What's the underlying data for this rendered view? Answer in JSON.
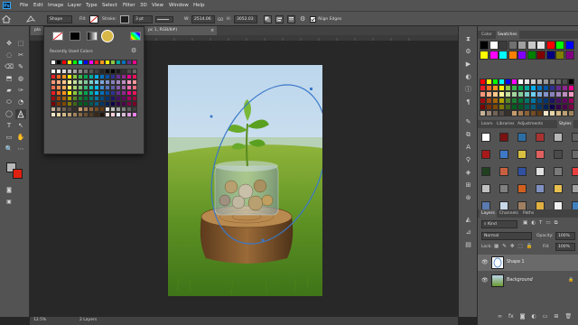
{
  "menubar": {
    "logo": "Ps",
    "items": [
      "File",
      "Edit",
      "Image",
      "Layer",
      "Type",
      "Select",
      "Filter",
      "3D",
      "View",
      "Window",
      "Help"
    ]
  },
  "options": {
    "mode": "Shape",
    "fill_label": "Fill:",
    "stroke_label": "Stroke:",
    "stroke_width": "3 pt",
    "w_label": "W:",
    "w_value": "2514.06",
    "link_glyph": "GO",
    "h_label": "H:",
    "h_value": "3052.03",
    "align_edges": "Align Edges"
  },
  "doc_tabs": [
    "pla",
    "pc 1, RGB/8#)"
  ],
  "swatch_flyout": {
    "title": "Recently Used Colors",
    "recent": [
      "#ffffff",
      "#000000",
      "#ff0000",
      "#ffff00",
      "#00ff00",
      "#00ffff",
      "#0000ff",
      "#ff00ff",
      "#ed1c24",
      "#f7941d",
      "#fff200",
      "#8dc63f",
      "#00a99d",
      "#0072bc",
      "#662d91",
      "#ec008c"
    ],
    "rows": [
      [
        "#ffffff",
        "#f2f2f2",
        "#d9d9d9",
        "#bfbfbf",
        "#a6a6a6",
        "#8c8c8c",
        "#737373",
        "#595959",
        "#404040",
        "#262626",
        "#0d0d0d",
        "#000000",
        "#1a1a1a",
        "#333333",
        "#4d4d4d",
        "#666666"
      ],
      [
        "#ed1c24",
        "#f26522",
        "#f7941d",
        "#fff200",
        "#8dc63f",
        "#39b54a",
        "#00a651",
        "#00a99d",
        "#00aeef",
        "#0072bc",
        "#0054a6",
        "#2e3192",
        "#662d91",
        "#92278f",
        "#ec008c",
        "#ed145b"
      ],
      [
        "#f69679",
        "#f9ad81",
        "#fdc689",
        "#fff799",
        "#c4df9b",
        "#a3d39c",
        "#82ca9c",
        "#7accc8",
        "#6dcff6",
        "#7da7d9",
        "#8393ca",
        "#8781bd",
        "#a187be",
        "#bd8cbf",
        "#f49ac1",
        "#f5989d"
      ],
      [
        "#f26c4f",
        "#f68e56",
        "#fbaf5d",
        "#fff568",
        "#acd373",
        "#7cc576",
        "#3bb878",
        "#1abbb4",
        "#00bff3",
        "#438ccb",
        "#5574b9",
        "#605ca8",
        "#8560a8",
        "#a864a8",
        "#f06eaa",
        "#f26d7d"
      ],
      [
        "#ed1c24",
        "#f26522",
        "#f7941d",
        "#fff200",
        "#8dc63f",
        "#39b54a",
        "#00a651",
        "#00a99d",
        "#00aeef",
        "#0072bc",
        "#0054a6",
        "#2e3192",
        "#662d91",
        "#92278f",
        "#ec008c",
        "#ed145b"
      ],
      [
        "#9e0b0f",
        "#a0410d",
        "#a36209",
        "#aba000",
        "#598527",
        "#1a7b30",
        "#007236",
        "#00746b",
        "#0076a3",
        "#004b80",
        "#003471",
        "#1b1464",
        "#440e62",
        "#630460",
        "#9e005d",
        "#9e0039"
      ],
      [
        "#790000",
        "#7b2e00",
        "#7d4900",
        "#827b00",
        "#406618",
        "#005e20",
        "#005826",
        "#005952",
        "#005b7f",
        "#003663",
        "#002157",
        "#0d004c",
        "#32004b",
        "#4b0049",
        "#7b0046",
        "#7a0026"
      ],
      [
        "#c7b299",
        "#998675",
        "#736357",
        "#534741",
        "#37302d",
        "#c69c6d",
        "#a67c52",
        "#8c6239",
        "#754c24",
        "#603913",
        "#e0e0e0",
        "#c0c0c0",
        "#a0a0a0",
        "#808080",
        "#606060",
        "#404040"
      ],
      [
        "#f3e6c8",
        "#e8d5a8",
        "#d4b98a",
        "#bda074",
        "#a0845c",
        "#856a45",
        "#6b5233",
        "#523c22",
        "#3a2815",
        "#20140a",
        "#ffe4e1",
        "#ffd1dc",
        "#e6e6fa",
        "#d8bfd8",
        "#dda0dd",
        "#ee82ee"
      ]
    ]
  },
  "tools": [
    "✥",
    "⬚",
    "◌",
    "✂",
    "⌫",
    "✎",
    "⬒",
    "◍",
    "▰",
    "✑",
    "⬭",
    "◔",
    "◯",
    "T",
    "↖",
    "▭",
    "✋",
    "🔍",
    "⋯"
  ],
  "right_panel": {
    "top_tabs": [
      "Color",
      "Swatches"
    ],
    "mid_tabs": [
      "Learn",
      "Libraries",
      "Adjustments",
      "Styles"
    ],
    "layers_tabs": [
      "Layers",
      "Channels",
      "Paths"
    ],
    "kind_label": "Kind",
    "blend_mode": "Normal",
    "opacity_label": "Opacity:",
    "opacity_value": "100%",
    "lock_label": "Lock:",
    "fill_label": "Fill:",
    "fill_value": "100%",
    "layers": [
      {
        "name": "Shape 1"
      },
      {
        "name": "Background"
      }
    ],
    "recent_swatches": [
      "#000000",
      "#ffffff",
      "#3b3b3b",
      "#707070",
      "#a0a0a0",
      "#c8c8c8",
      "#e6e6e6",
      "#ff0000",
      "#00ff00",
      "#0000ff",
      "#ffff00",
      "#ff00ff",
      "#00ffff",
      "#ff8000",
      "#8000ff",
      "#008000",
      "#800000",
      "#000080",
      "#808000",
      "#800080"
    ],
    "swatch_rows": [
      [
        "#ff0000",
        "#ffff00",
        "#00ff00",
        "#00ffff",
        "#0000ff",
        "#ff00ff",
        "#ffffff",
        "#e6e6e6",
        "#cccccc",
        "#b3b3b3",
        "#999999",
        "#808080",
        "#666666",
        "#4d4d4d",
        "#000000"
      ],
      [
        "#ed1c24",
        "#f26522",
        "#f7941d",
        "#fff200",
        "#8dc63f",
        "#39b54a",
        "#00a651",
        "#00a99d",
        "#00aeef",
        "#0072bc",
        "#0054a6",
        "#2e3192",
        "#662d91",
        "#92278f",
        "#ec008c"
      ],
      [
        "#f69679",
        "#f9ad81",
        "#fdc689",
        "#fff799",
        "#c4df9b",
        "#a3d39c",
        "#82ca9c",
        "#7accc8",
        "#6dcff6",
        "#7da7d9",
        "#8393ca",
        "#8781bd",
        "#a187be",
        "#bd8cbf",
        "#f49ac1"
      ],
      [
        "#9e0b0f",
        "#a0410d",
        "#a36209",
        "#aba000",
        "#598527",
        "#1a7b30",
        "#007236",
        "#00746b",
        "#0076a3",
        "#004b80",
        "#003471",
        "#1b1464",
        "#440e62",
        "#630460",
        "#9e005d"
      ],
      [
        "#790000",
        "#7b2e00",
        "#7d4900",
        "#827b00",
        "#406618",
        "#005e20",
        "#005826",
        "#005952",
        "#005b7f",
        "#003663",
        "#002157",
        "#0d004c",
        "#32004b",
        "#4b0049",
        "#7b0046"
      ],
      [
        "#c7b299",
        "#998675",
        "#736357",
        "#534741",
        "#37302d",
        "#c69c6d",
        "#a67c52",
        "#8c6239",
        "#754c24",
        "#603913",
        "#f3e6c8",
        "#e8d5a8",
        "#d4b98a",
        "#bda074",
        "#a0845c"
      ]
    ],
    "style_tiles": [
      "#ffffff",
      "#7a1212",
      "#2c6ea3",
      "#a83232",
      "#b8b8b8",
      "#606060",
      "#a81818",
      "#3e78c8",
      "#d8c040",
      "#e06060",
      "#4a4a4a",
      "#6a6a6a",
      "#204020",
      "#c86040",
      "#3050a0",
      "#e0e0e0",
      "#7a7a7a",
      "#e84040",
      "#c0c0c0",
      "#808080",
      "#d06020",
      "#8090c0",
      "#e8c050",
      "#a0a0a0",
      "#5a7ab0",
      "#c8d8e8",
      "#a08060",
      "#e0b040",
      "#f0f0f0",
      "#4080c0"
    ]
  },
  "statusbar": {
    "zoom": "12.5%",
    "layers_count": "2 Layers"
  }
}
